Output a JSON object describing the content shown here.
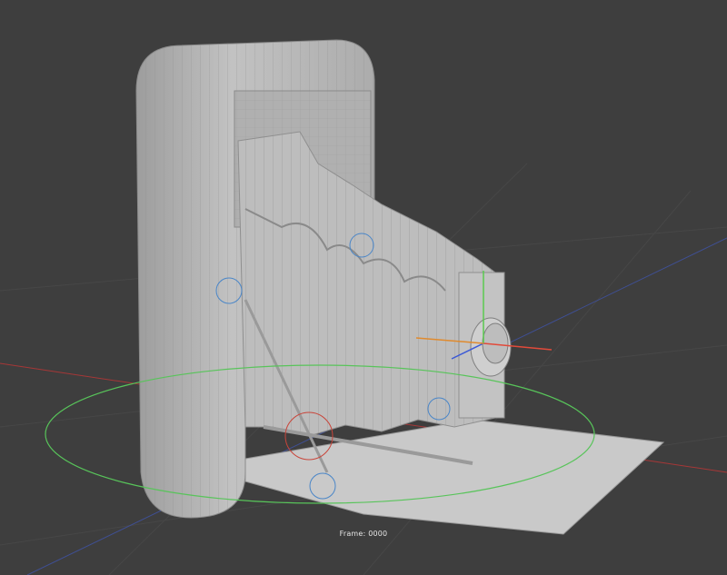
{
  "viewport": {
    "frame_label": "Frame: 0000",
    "colors": {
      "background": "#3e3e3e",
      "grid": "#4a4a4a",
      "axis_x": "#b43a3a",
      "axis_y_line": "#4b5fa8",
      "ring_green": "#58c45a",
      "handle_blue": "#4a86c8",
      "mesh": "#b8b8b8",
      "mesh_wire": "#8e8e8e"
    },
    "icons": [
      "rotate-ring-z",
      "rotate-handle-blue",
      "gizmo-axes"
    ]
  }
}
